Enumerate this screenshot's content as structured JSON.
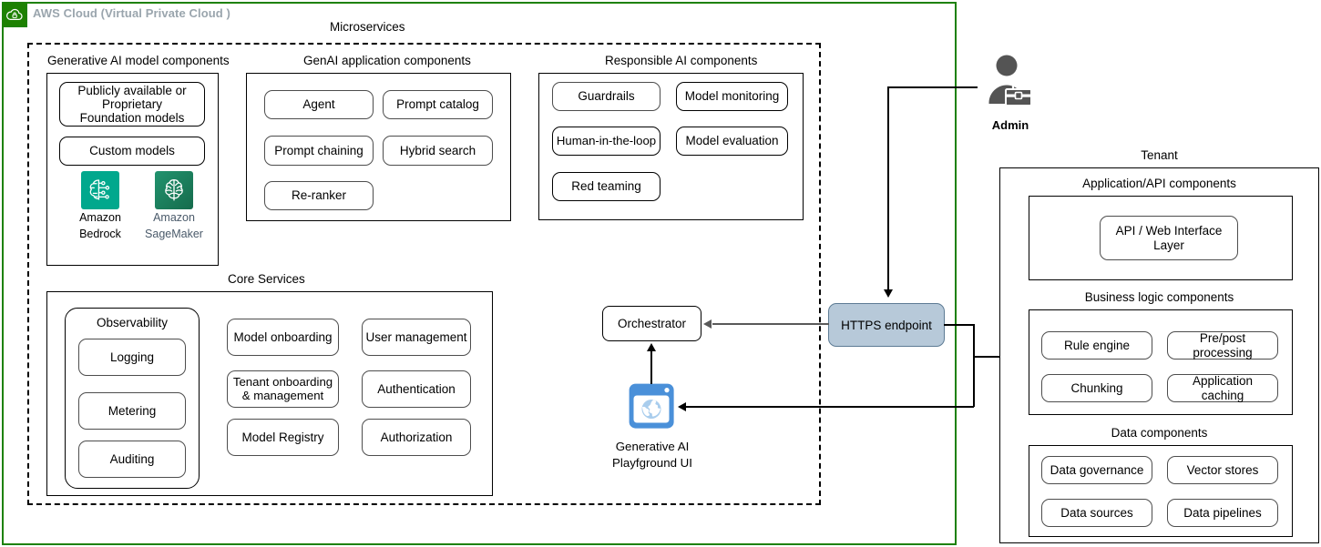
{
  "cloud": {
    "title": "AWS Cloud (Virtual Private Cloud )",
    "icon": "vpc-cloud-lock-icon",
    "border_color": "#1d8102",
    "badge_color": "#1d8102",
    "title_color": "#9aa5ad"
  },
  "microservices": {
    "label": "Microservices",
    "groups": {
      "genai_model": {
        "label": "Generative AI model components",
        "chips": [
          "Publicly available or\nProprietary\nFoundation models",
          "Custom models"
        ],
        "services": [
          {
            "name": "Amazon\nBedrock",
            "icon": "amazon-bedrock-icon",
            "color": "#01a88d",
            "label_color": "#000000"
          },
          {
            "name": "Amazon\nSageMaker",
            "icon": "amazon-sagemaker-icon",
            "color": "#1f7a5a",
            "label_color": "#4a5a6a"
          }
        ]
      },
      "genai_application": {
        "label": "GenAI application components",
        "chips": [
          "Agent",
          "Prompt catalog",
          "Prompt chaining",
          "Hybrid search",
          "Re-ranker"
        ]
      },
      "responsible_ai": {
        "label": "Responsible AI components",
        "chips": [
          "Guardrails",
          "Model monitoring",
          "Human-in-the-loop",
          "Model evaluation",
          "Red teaming"
        ]
      },
      "core_services": {
        "label": "Core Services",
        "observability": {
          "label": "Observability",
          "chips": [
            "Logging",
            "Metering",
            "Auditing"
          ]
        },
        "column_two": [
          "Model onboarding",
          "Tenant onboarding\n& management",
          "Model Registry"
        ],
        "column_three": [
          "User management",
          "Authentication",
          "Authorization"
        ]
      }
    }
  },
  "orchestrator": {
    "label": "Orchestrator"
  },
  "playground": {
    "caption": "Generative AI\nPlayfground UI",
    "icon": "browser-globe-icon",
    "color": "#4a90d9"
  },
  "https_endpoint": {
    "label": "HTTPS endpoint",
    "fill": "#b7c9d9",
    "stroke": "#5d7b94"
  },
  "admin": {
    "label": "Admin",
    "icon": "admin-person-toolbox-icon",
    "color": "#545454"
  },
  "tenant": {
    "label": "Tenant",
    "groups": [
      {
        "label": "Application/API components",
        "chips": [
          "API / Web Interface\nLayer"
        ]
      },
      {
        "label": "Business logic components",
        "chips": [
          "Rule engine",
          "Pre/post\nprocessing",
          "Chunking",
          "Application\ncaching"
        ]
      },
      {
        "label": "Data components",
        "chips": [
          "Data governance",
          "Vector stores",
          "Data sources",
          "Data pipelines"
        ]
      }
    ]
  }
}
